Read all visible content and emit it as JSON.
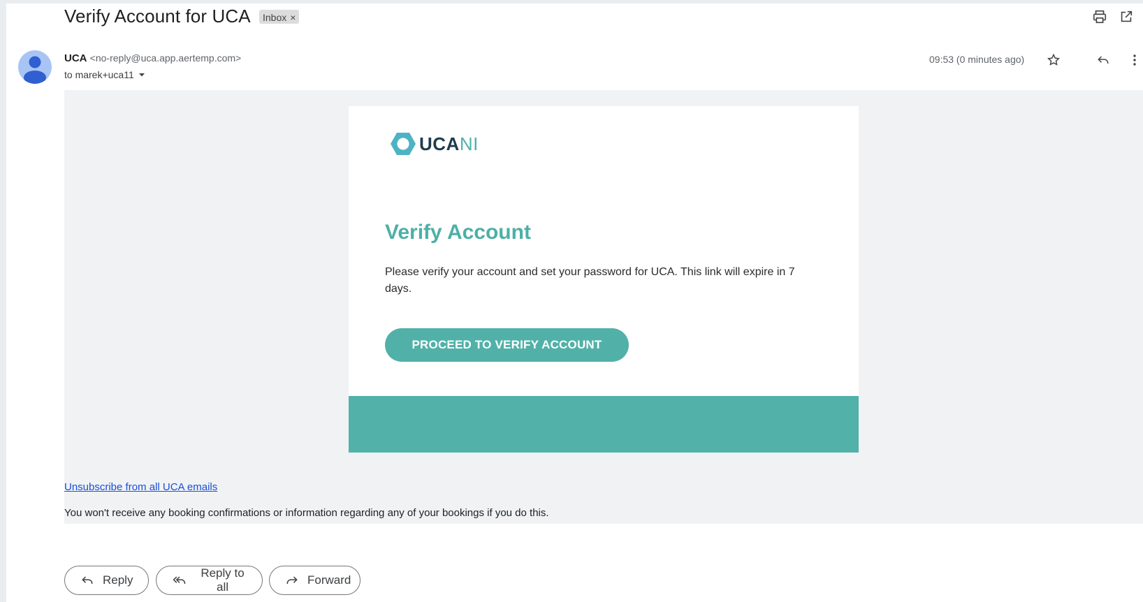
{
  "header": {
    "subject": "Verify Account for UCA",
    "label_chip": "Inbox",
    "label_chip_close": "×"
  },
  "message": {
    "sender_name": "UCA",
    "sender_email": "<no-reply@uca.app.aertemp.com>",
    "to_line": "to marek+uca11",
    "time": "09:53 (0 minutes ago)"
  },
  "email_body": {
    "logo_text_main": "UCA",
    "logo_text_accent": "NI",
    "title": "Verify Account",
    "text": "Please verify your account and set your password for UCA. This link will expire in 7 days.",
    "cta_label": "PROCEED TO VERIFY ACCOUNT",
    "unsubscribe_link": "Unsubscribe from all UCA emails",
    "unsubscribe_note": "You won't receive any booking confirmations or information regarding any of your bookings if you do this."
  },
  "actions": {
    "reply": "Reply",
    "reply_all": "Reply to all",
    "forward": "Forward"
  },
  "colors": {
    "accent": "#51b1a8",
    "title": "#4db0a6",
    "link": "#1a4ed8"
  },
  "icons": [
    "print-icon",
    "open-in-new-icon",
    "star-icon",
    "reply-icon",
    "more-vert-icon",
    "dropdown-icon",
    "reply-all-icon",
    "forward-icon"
  ]
}
